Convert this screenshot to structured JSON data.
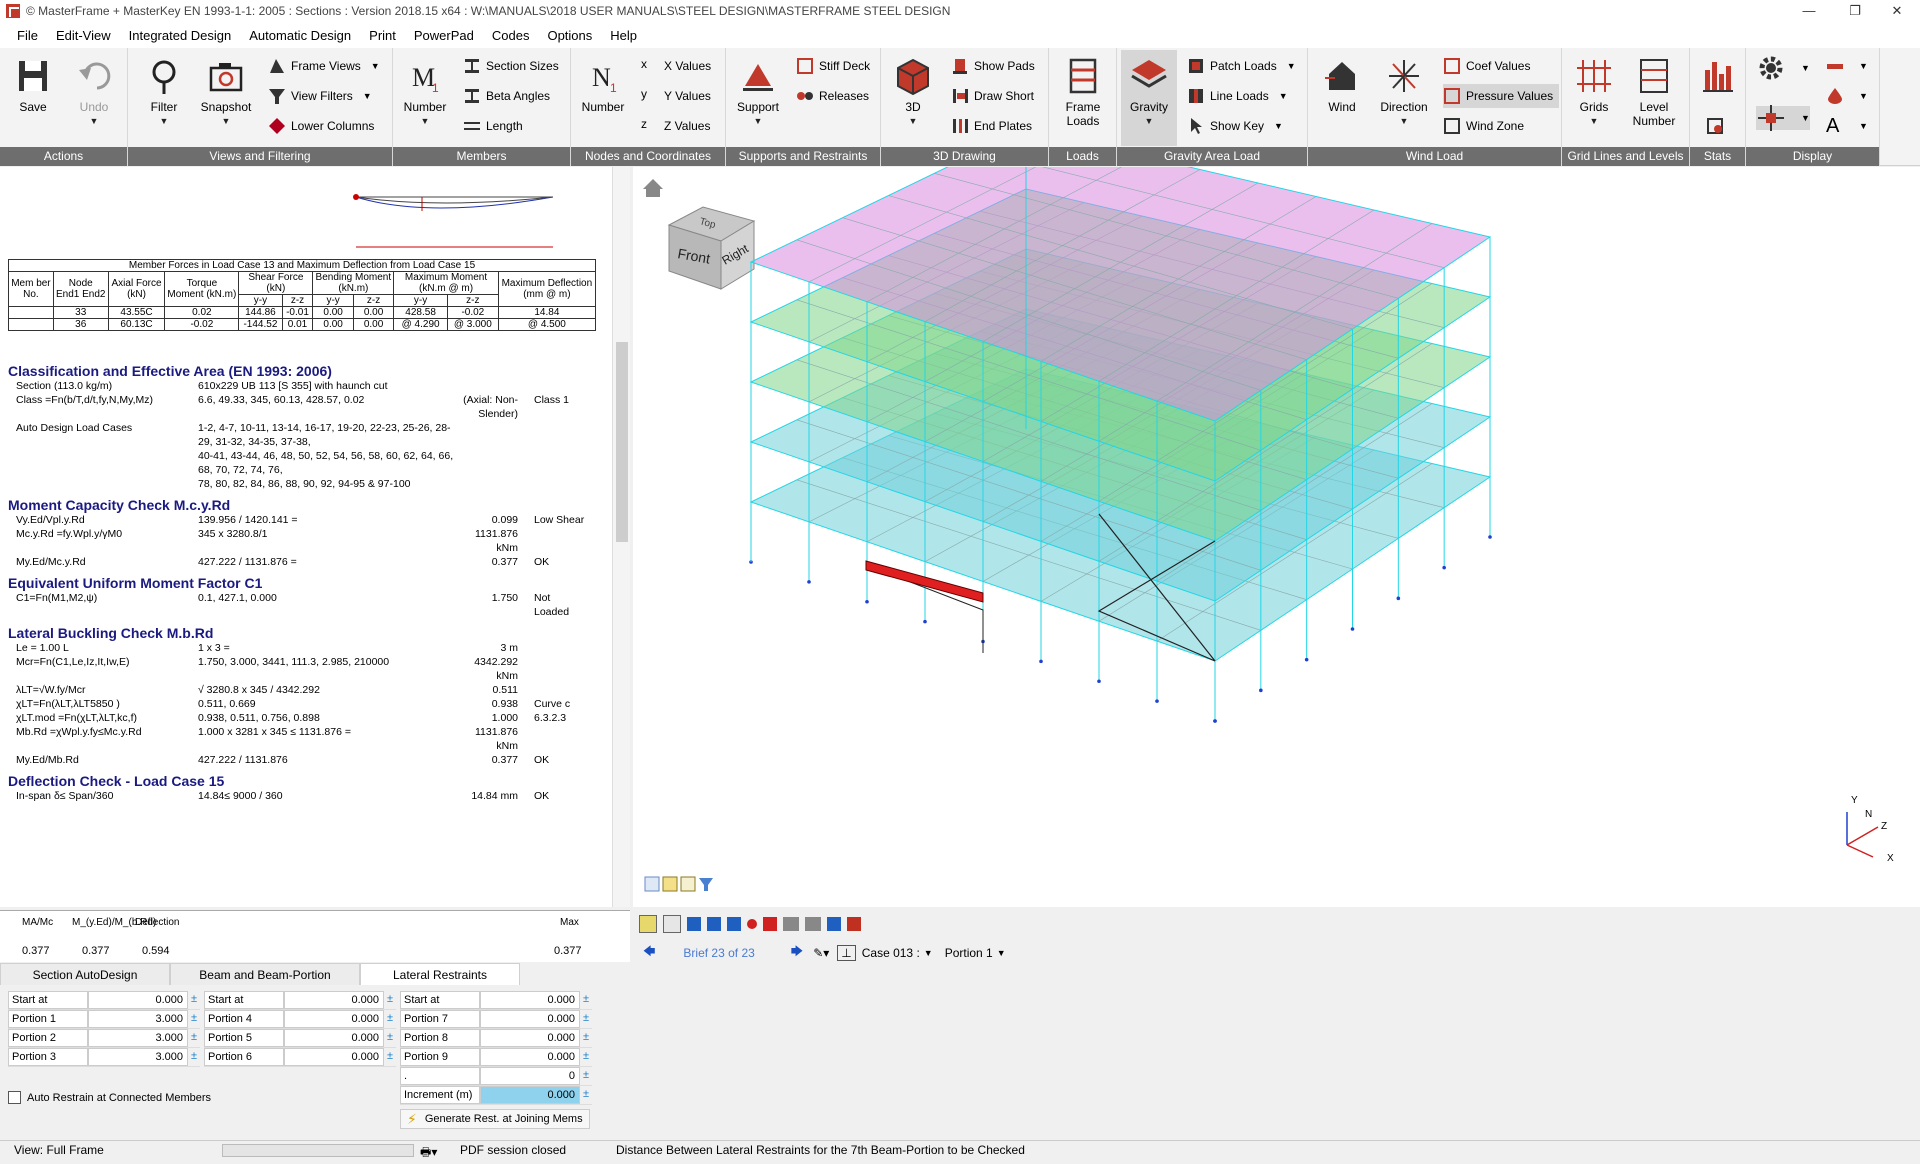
{
  "titlebar": {
    "text": "© MasterFrame + MasterKey EN 1993-1-1: 2005 : Sections : Version 2018.15 x64 : W:\\MANUALS\\2018 USER MANUALS\\STEEL DESIGN\\MASTERFRAME STEEL DESIGN"
  },
  "menu": [
    "File",
    "Edit-View",
    "Integrated Design",
    "Automatic Design",
    "Print",
    "PowerPad",
    "Codes",
    "Options",
    "Help"
  ],
  "ribbon": {
    "groups": [
      "Actions",
      "Views and Filtering",
      "Members",
      "Nodes and Coordinates",
      "Supports and Restraints",
      "3D Drawing",
      "Loads",
      "Gravity Area Load",
      "Wind Load",
      "Grid Lines and Levels",
      "Stats",
      "Display"
    ],
    "save": "Save",
    "undo": "Undo",
    "filter": "Filter",
    "snapshot": "Snapshot",
    "frame_views": "Frame Views",
    "view_filters": "View Filters",
    "lower_columns": "Lower Columns",
    "number": "Number",
    "section_sizes": "Section Sizes",
    "beta_angles": "Beta Angles",
    "length": "Length",
    "node_number": "Number",
    "x_values": "X Values",
    "y_values": "Y Values",
    "z_values": "Z Values",
    "support": "Support",
    "stiff_deck": "Stiff Deck",
    "releases": "Releases",
    "threed": "3D",
    "show_pads": "Show Pads",
    "draw_short": "Draw Short",
    "end_plates": "End Plates",
    "frame_loads": "Frame Loads",
    "gravity": "Gravity",
    "patch_loads": "Patch Loads",
    "line_loads": "Line Loads",
    "show_key": "Show Key",
    "wind": "Wind",
    "direction": "Direction",
    "coef_values": "Coef Values",
    "pressure_values": "Pressure Values",
    "wind_zone": "Wind Zone",
    "grids": "Grids",
    "level_number": "Level Number"
  },
  "report": {
    "table_title": "Member Forces in Load Case 13 and Maximum Deflection from Load Case 15",
    "headers": [
      "Mem ber No.",
      "Node End1 End2",
      "Axial Force (kN)",
      "Torque Moment (kN.m)",
      "Shear Force (kN)",
      "Bending Moment (kN.m)",
      "Maximum Moment (kN.m @ m)",
      "Maximum Deflection (mm @ m)"
    ],
    "sub_yy": "y-y",
    "sub_zz": "z-z",
    "rows": [
      [
        "",
        "33",
        "43.55C",
        "0.02",
        "144.86",
        "-0.01",
        "0.00",
        "0.00",
        "428.58",
        "-0.02",
        "14.84"
      ],
      [
        "",
        "36",
        "60.13C",
        "-0.02",
        "-144.52",
        "0.01",
        "0.00",
        "0.00",
        "@ 4.290",
        "@ 3.000",
        "@ 4.500"
      ]
    ],
    "sec1_title": "Classification and Effective Area (EN 1993: 2006)",
    "sec1": [
      [
        "Section (113.0 kg/m)",
        "610x229 UB 113 [S 355] with  haunch cut",
        "",
        ""
      ],
      [
        "Class =Fn(b/T,d/t,fy,N,My,Mz)",
        "6.6, 49.33, 345, 60.13, 428.57, 0.02",
        "(Axial: Non-Slender)",
        "Class 1"
      ],
      [
        "Auto Design Load Cases",
        "1-2, 4-7, 10-11, 13-14, 16-17, 19-20, 22-23, 25-26, 28-29, 31-32, 34-35, 37-38,",
        "",
        ""
      ],
      [
        "",
        "40-41, 43-44, 46, 48, 50, 52, 54, 56, 58, 60, 62, 64, 66, 68, 70, 72, 74, 76,",
        "",
        ""
      ],
      [
        "",
        "78, 80, 82, 84, 86, 88, 90, 92, 94-95 & 97-100",
        "",
        ""
      ]
    ],
    "sec2_title": "Moment Capacity Check M.c.y.Rd",
    "sec2": [
      [
        "Vy.Ed/Vpl.y.Rd",
        "139.956 / 1420.141 =",
        "0.099",
        "Low Shear"
      ],
      [
        "Mc.y.Rd =fy.Wpl.y/γM0",
        "345 x 3280.8/1",
        "1131.876 kNm",
        ""
      ],
      [
        "My.Ed/Mc.y.Rd",
        "427.222 / 1131.876 =",
        "0.377",
        "OK"
      ]
    ],
    "sec3_title": "Equivalent Uniform Moment Factor C1",
    "sec3": [
      [
        "C1=Fn(M1,M2,ψ)",
        "0.1, 427.1, 0.000",
        "1.750",
        "Not Loaded"
      ]
    ],
    "sec4_title": "Lateral Buckling Check M.b.Rd",
    "sec4": [
      [
        "Le = 1.00 L",
        "1 x 3 =",
        "3 m",
        ""
      ],
      [
        "Mcr=Fn(C1,Le,Iz,It,Iw,E)",
        "1.750, 3.000, 3441, 111.3, 2.985, 210000",
        "4342.292 kNm",
        ""
      ],
      [
        "λLT=√W.fy/Mcr",
        "√ 3280.8 x 345 / 4342.292",
        "0.511",
        ""
      ],
      [
        "χLT=Fn(λLT,λLT5850 )",
        "0.511, 0.669",
        "0.938",
        "Curve c"
      ],
      [
        "χLT.mod =Fn(χLT,λLT,kc,f)",
        "0.938, 0.511, 0.756, 0.898",
        "1.000",
        "6.3.2.3"
      ],
      [
        "Mb.Rd =χWpl.y.fy≤Mc.y.Rd",
        "1.000 x 3281 x 345 ≤ 1131.876 =",
        "1131.876 kNm",
        ""
      ],
      [
        "My.Ed/Mb.Rd",
        "427.222 / 1131.876",
        "0.377",
        "OK"
      ]
    ],
    "sec5_title": "Deflection Check - Load Case 15",
    "sec5": [
      [
        "In-span δ≤ Span/360",
        "14.84≤ 9000 / 360",
        "14.84 mm",
        "OK"
      ]
    ]
  },
  "summary": {
    "h1": "MA/Mc",
    "h2": "M_(y.Ed)/M_(b.Rd)",
    "h3": "Deflection",
    "h4": "Max",
    "v1": "0.377",
    "v2": "0.377",
    "v3": "0.594",
    "v4": "0.377"
  },
  "tabs": [
    "Section AutoDesign",
    "Beam and Beam-Portion",
    "Lateral Restraints"
  ],
  "restraints": {
    "col1": [
      [
        "Start at",
        "0.000"
      ],
      [
        "Portion 1",
        "3.000"
      ],
      [
        "Portion 2",
        "3.000"
      ],
      [
        "Portion 3",
        "3.000"
      ]
    ],
    "col2": [
      [
        "Start at",
        "0.000"
      ],
      [
        "Portion 4",
        "0.000"
      ],
      [
        "Portion 5",
        "0.000"
      ],
      [
        "Portion 6",
        "0.000"
      ]
    ],
    "col3": [
      [
        "Start at",
        "0.000"
      ],
      [
        "Portion 7",
        "0.000"
      ],
      [
        "Portion 8",
        "0.000"
      ],
      [
        "Portion 9",
        "0.000"
      ],
      [
        ".",
        "0"
      ],
      [
        "Increment (m)",
        "0.000"
      ]
    ],
    "auto_restrain": "Auto Restrain at Connected Members",
    "generate": "Generate Rest. at Joining Mems"
  },
  "viewport": {
    "cube_top": "Top",
    "cube_front": "Front",
    "cube_right": "Right",
    "axis_y": "Y",
    "axis_n": "N",
    "axis_z": "Z",
    "axis_x": "X"
  },
  "nav": {
    "brief": "Brief 23 of 23",
    "case": "Case 013 :",
    "portion": "Portion 1"
  },
  "status": {
    "view": "View: Full Frame",
    "pdf": "PDF session closed",
    "message": "Distance Between Lateral Restraints for the 7th Beam-Portion to be Checked"
  },
  "colors": {
    "ribbon_group_bar": "#6e6e6e",
    "title_blue": "#1a1a80",
    "slab_magenta": "#d98be0",
    "slab_green": "#7fd68a",
    "slab_cyan": "#6fd0d8",
    "selected_member": "#e02020"
  }
}
